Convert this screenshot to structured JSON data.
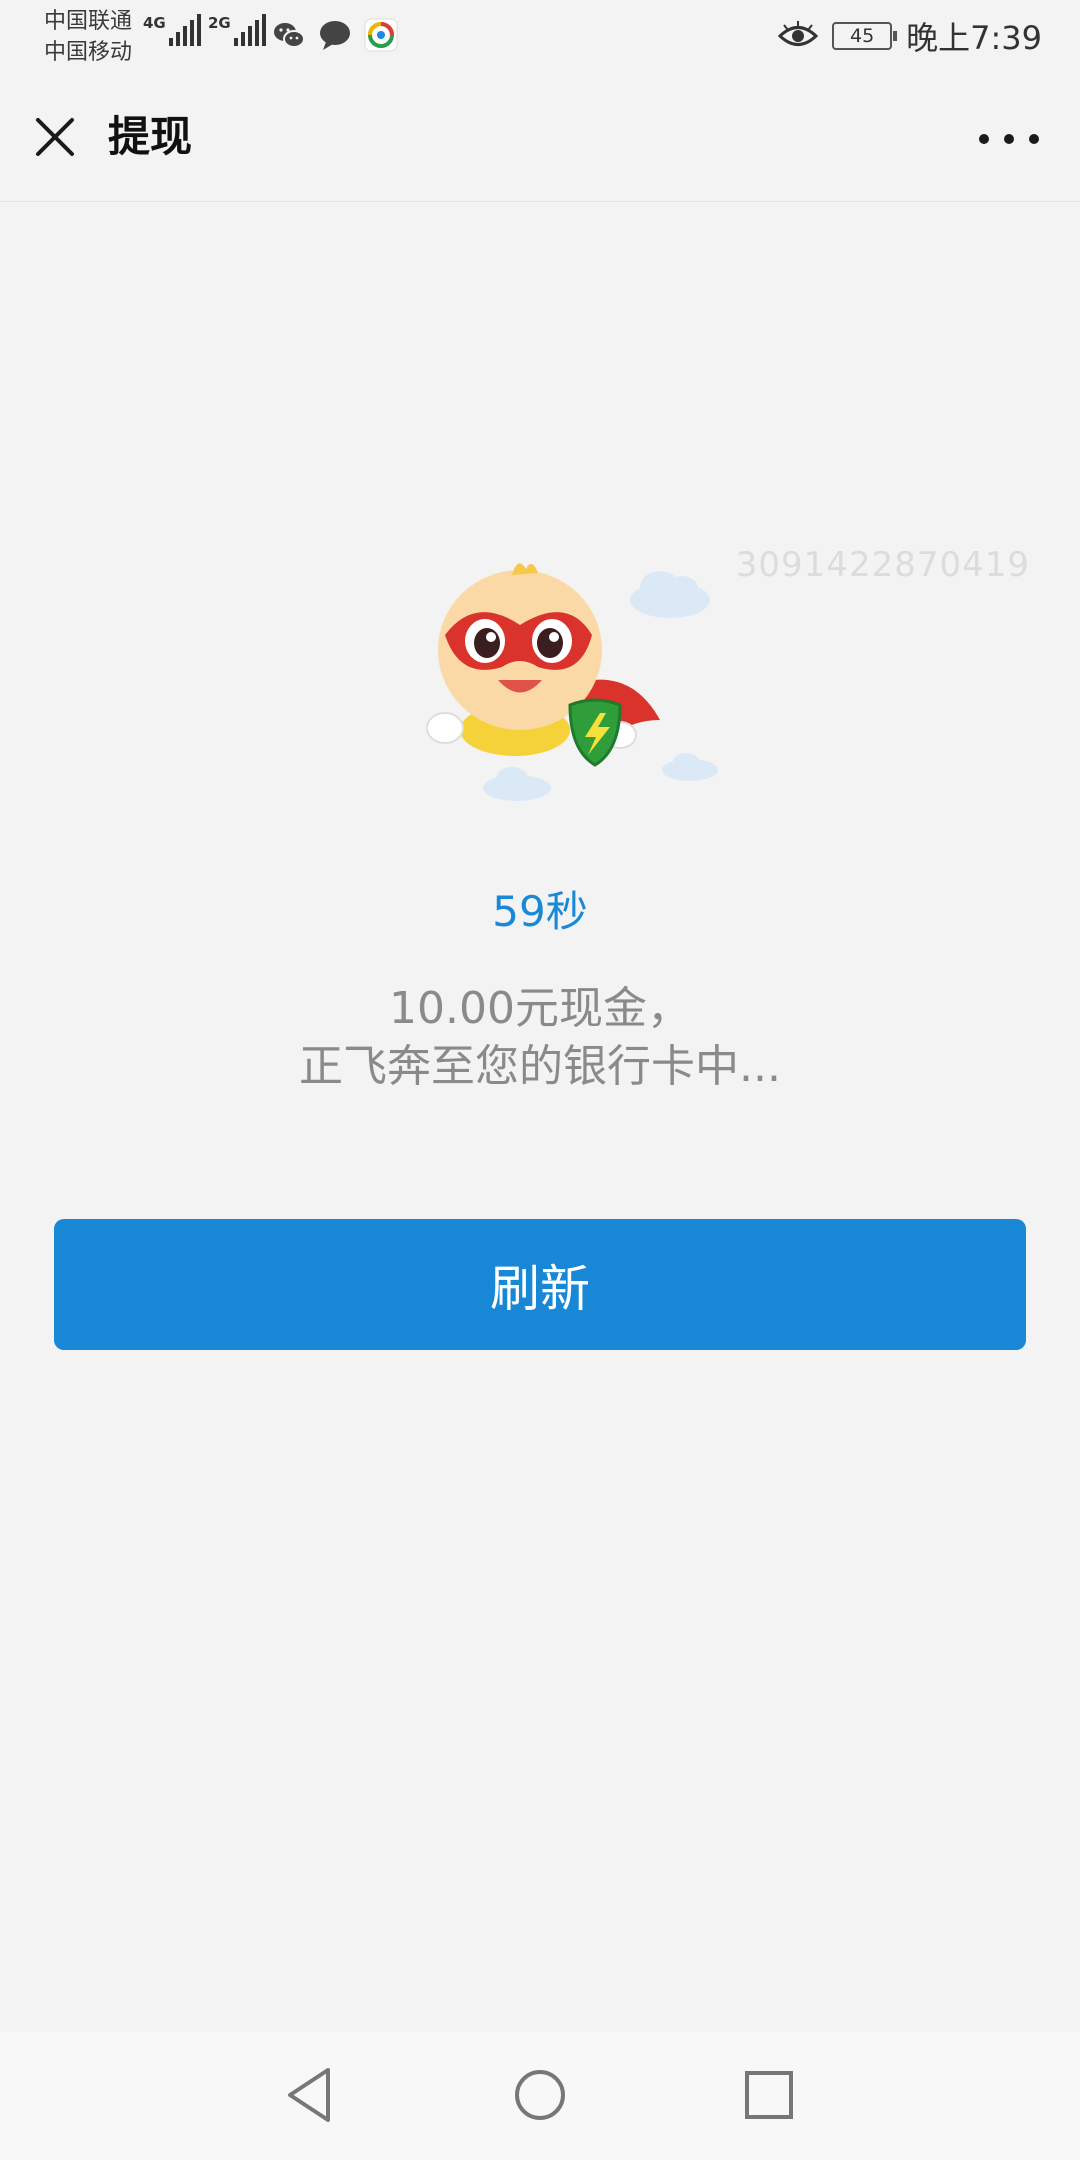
{
  "status_bar": {
    "carrier_1": "中国联通",
    "carrier_2": "中国移动",
    "network_1": "4G",
    "network_2": "2G",
    "battery": "45",
    "time": "晚上7:39",
    "icons": [
      "wechat-icon",
      "message-icon",
      "browser-icon",
      "eye-icon"
    ]
  },
  "nav": {
    "title": "提现",
    "close_icon": "close-icon",
    "more_icon": "more-icon"
  },
  "content": {
    "watermark": "3091422870419",
    "countdown": "59秒",
    "message_line1": "10.00元现金，",
    "message_line2": "正飞奔至您的银行卡中...",
    "refresh_label": "刷新"
  },
  "colors": {
    "accent": "#1787d6",
    "countdown": "#1989d6",
    "background": "#f3f3f3",
    "message": "#8a8a8a"
  }
}
